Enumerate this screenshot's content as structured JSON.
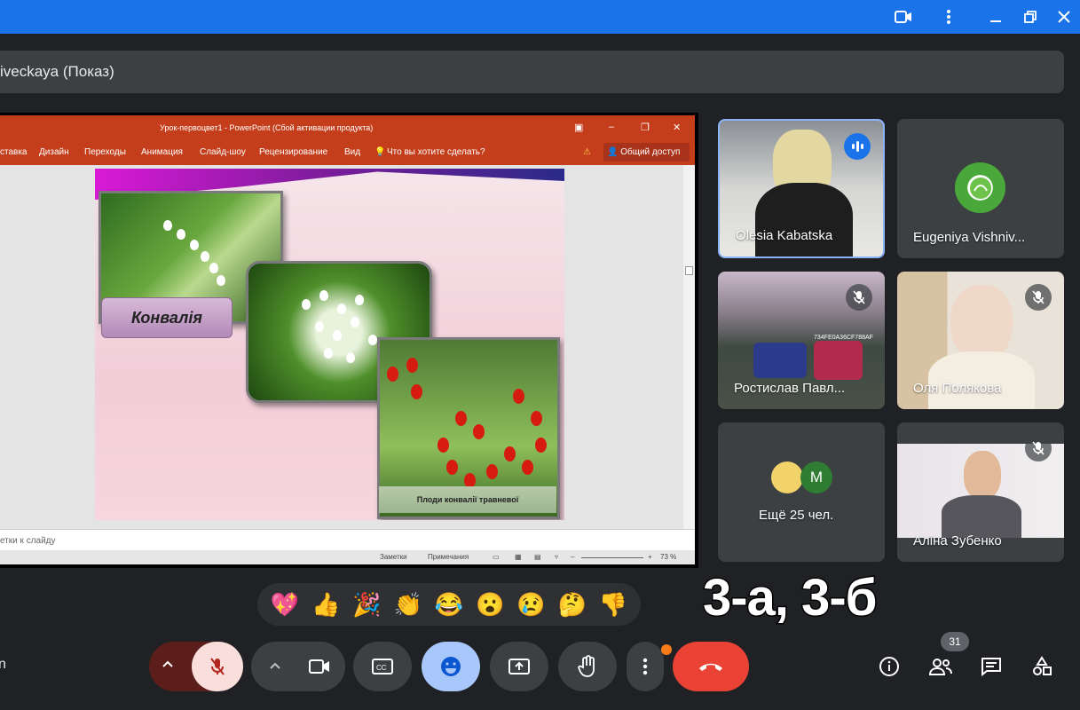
{
  "colors": {
    "accent": "#1a73e8",
    "end_call": "#ea4335",
    "background": "#202124"
  },
  "meeting": {
    "presenter_bar": "iveckaya (Показ)",
    "left_label": "n"
  },
  "powerpoint": {
    "title": "Урок-первоцвет1 - PowerPoint (Сбой активации продукта)",
    "ribbon": [
      "ставка",
      "Дизайн",
      "Переходы",
      "Анимация",
      "Слайд-шоу",
      "Рецензирование",
      "Вид"
    ],
    "search_hint": "Что вы хотите сделать?",
    "share_label": "Общий доступ",
    "notes": "етки к слайду",
    "status_notes": "Заметки",
    "status_comments": "Примечания",
    "zoom": "73 %",
    "slide": {
      "label": "Конвалія",
      "caption": "Плоди конвалії травневої"
    }
  },
  "participants": [
    {
      "name": "Olesia Kabatska",
      "speaking": true
    },
    {
      "name": "Eugeniya Vishniv..."
    },
    {
      "name": "Ростислав Павл...",
      "muted": true,
      "plate": "734FE0A36CF788AF"
    },
    {
      "name": "Оля Полякова",
      "muted": true
    },
    {
      "name": "Ещё 25 чел.",
      "avatar_letter": "M"
    },
    {
      "name": "Аліна Зубенко",
      "muted": true
    }
  ],
  "reactions": [
    "💖",
    "👍",
    "🎉",
    "👏",
    "😂",
    "😮",
    "😢",
    "🤔",
    "👎"
  ],
  "caption_overlay": "3-а, 3-б",
  "people_count": "31",
  "icons": {
    "window": [
      "camera-icon",
      "more-vert-icon",
      "minimize-icon",
      "restore-icon",
      "close-icon"
    ],
    "controls": [
      "chevron-up-icon",
      "mic-off-icon",
      "camera-icon",
      "captions-icon",
      "emoji-icon",
      "present-icon",
      "hand-icon",
      "more-vert-icon",
      "call-end-icon"
    ],
    "side": [
      "info-icon",
      "people-icon",
      "chat-icon",
      "activities-icon"
    ]
  }
}
